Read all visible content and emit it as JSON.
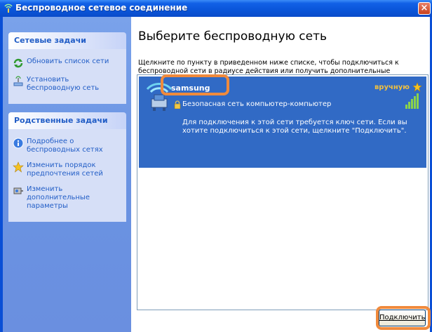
{
  "window": {
    "title": "Беспроводное сетевое соединение",
    "close_label": "×"
  },
  "taskpane": {
    "network_tasks": {
      "header": "Сетевые задачи",
      "items": [
        {
          "label": "Обновить список сети",
          "icon": "refresh-icon"
        },
        {
          "label": "Установить беспроводную сеть",
          "icon": "wireless-setup-icon"
        }
      ]
    },
    "related_tasks": {
      "header": "Родственные задачи",
      "items": [
        {
          "label": "Подробнее о беспроводных сетях",
          "icon": "info-icon"
        },
        {
          "label": "Изменить порядок предпочтения сетей",
          "icon": "star-icon"
        },
        {
          "label": "Изменить дополнительные параметры",
          "icon": "settings-icon"
        }
      ]
    }
  },
  "main": {
    "title": "Выберите беспроводную сеть",
    "description": "Щелкните по пункту в приведенном ниже списке, чтобы подключиться к беспроводной сети в радиусе действия или получить дополнительные сведения.",
    "networks": [
      {
        "name": "samsung",
        "mode": "вручную",
        "security": "Безопасная сеть компьютер-компьютер",
        "info": "Для подключения к этой сети требуется ключ сети. Если вы хотите подключиться к этой сети, щелкните \"Подключить\".",
        "selected": true
      }
    ],
    "connect_button": "Подключить"
  },
  "colors": {
    "titlebar": "#0a55d9",
    "selection": "#316ac5",
    "highlight_outline": "#f08a3c",
    "task_link": "#215dc6"
  }
}
